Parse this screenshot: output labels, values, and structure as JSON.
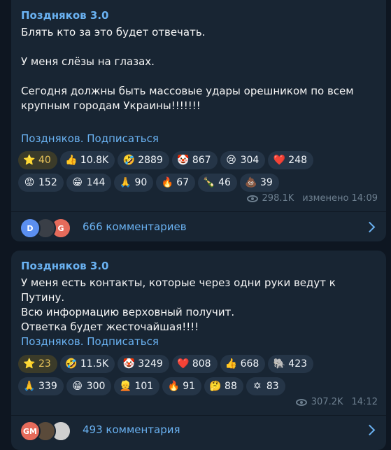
{
  "posts": [
    {
      "author": "Поздняков 3.0",
      "text": "Блять кто за это будет отвечать.\n\nУ меня слёзы на глазах.\n\nСегодня должны быть массовые удары орешником по всем крупным городам Украины!!!!!!!",
      "subscribe_link": "Поздняков. Подписаться",
      "reactions_row1": [
        {
          "emoji": "⭐",
          "icon": "star-icon",
          "count": "40",
          "star": true
        },
        {
          "emoji": "👍",
          "icon": "thumbs-up-icon",
          "count": "10.8K"
        },
        {
          "emoji": "🤣",
          "icon": "rofl-icon",
          "count": "2889"
        },
        {
          "emoji": "🤡",
          "icon": "clown-icon",
          "count": "867"
        },
        {
          "emoji": "😢",
          "icon": "crying-icon",
          "count": "304"
        },
        {
          "emoji": "❤️",
          "icon": "heart-icon",
          "count": "248"
        }
      ],
      "reactions_row2": [
        {
          "emoji": "😡",
          "icon": "angry-icon",
          "count": "152"
        },
        {
          "emoji": "😁",
          "icon": "grin-icon",
          "count": "144"
        },
        {
          "emoji": "🙏",
          "icon": "pray-icon",
          "count": "90"
        },
        {
          "emoji": "🔥",
          "icon": "fire-icon",
          "count": "67"
        },
        {
          "emoji": "🍾",
          "icon": "champagne-icon",
          "count": "46"
        },
        {
          "emoji": "💩",
          "icon": "poop-icon",
          "count": "39"
        }
      ],
      "views": "298.1K",
      "time": "изменено 14:09",
      "comments_label": "666 комментариев",
      "avatars": [
        {
          "letter": "D",
          "color": "#5b8ff0"
        },
        {
          "letter": "",
          "color": "#3a3f47"
        },
        {
          "letter": "G",
          "color": "#e66b5b"
        }
      ]
    },
    {
      "author": "Поздняков 3.0",
      "text": "У меня есть контакты, которые через одни руки ведут к Путину.\nВсю информацию верховный получит.\nОтветка будет жесточайшая!!!!",
      "subscribe_link": "Поздняков. Подписаться",
      "reactions_row1": [
        {
          "emoji": "⭐",
          "icon": "star-icon",
          "count": "23",
          "star": true
        },
        {
          "emoji": "🤣",
          "icon": "rofl-icon",
          "count": "11.5K"
        },
        {
          "emoji": "🤡",
          "icon": "clown-icon",
          "count": "3249"
        },
        {
          "emoji": "❤️",
          "icon": "heart-icon",
          "count": "808"
        },
        {
          "emoji": "👍",
          "icon": "thumbs-up-icon",
          "count": "668"
        },
        {
          "emoji": "🐘",
          "icon": "elephant-icon",
          "count": "423"
        }
      ],
      "reactions_row2": [
        {
          "emoji": "🙏",
          "icon": "pray-icon",
          "count": "339"
        },
        {
          "emoji": "😁",
          "icon": "grin-icon",
          "count": "300"
        },
        {
          "emoji": "👱",
          "icon": "custom-face-icon",
          "count": "101"
        },
        {
          "emoji": "🔥",
          "icon": "fire-icon",
          "count": "91"
        },
        {
          "emoji": "🤔",
          "icon": "thinking-icon",
          "count": "88"
        },
        {
          "emoji": "✡",
          "icon": "star-of-david-icon",
          "count": "83"
        }
      ],
      "views": "307.2K",
      "time": "14:12",
      "comments_label": "493 комментария",
      "avatars": [
        {
          "letter": "GM",
          "color": "#e66b5b"
        },
        {
          "letter": "",
          "color": "#5a4a3a"
        },
        {
          "letter": "",
          "color": "#cfcfcf"
        }
      ]
    }
  ]
}
